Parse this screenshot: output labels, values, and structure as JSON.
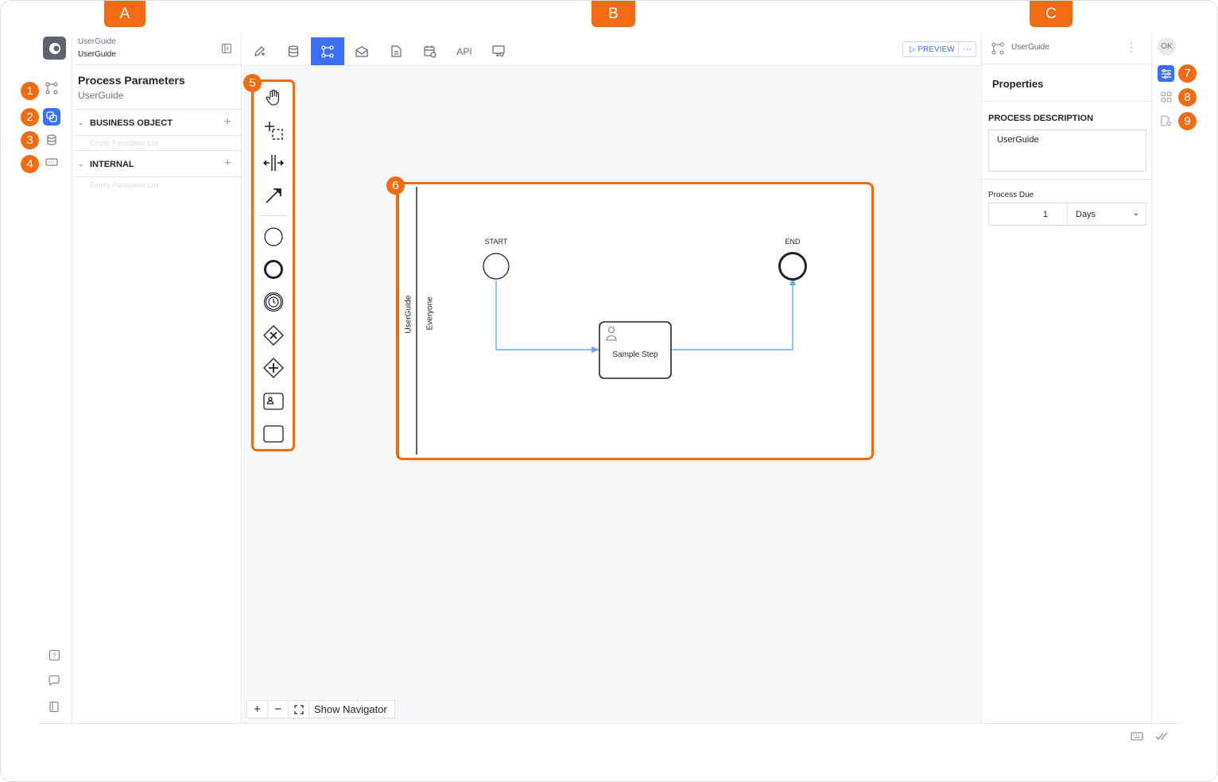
{
  "markers": {
    "a": "A",
    "b": "B",
    "c": "C",
    "n1": "1",
    "n2": "2",
    "n3": "3",
    "n4": "4",
    "n5": "5",
    "n6": "6",
    "n7": "7",
    "n8": "8",
    "n9": "9"
  },
  "app": {
    "project": "UserGuide",
    "process": "UserGuide"
  },
  "left_rail": {
    "items": [
      "process-flow-icon",
      "objects-icon",
      "database-icon",
      "input-icon"
    ],
    "bottom": [
      "help-icon",
      "chat-icon",
      "book-icon"
    ]
  },
  "parameters": {
    "title": "Process Parameters",
    "subtitle": "UserGuide",
    "sections": [
      {
        "label": "BUSINESS OBJECT",
        "empty": "Empty Parameter List"
      },
      {
        "label": "INTERNAL",
        "empty": "Empty Parameter List"
      }
    ]
  },
  "toolbar": {
    "api_label": "API",
    "preview_label": "PREVIEW",
    "more": "···"
  },
  "diagram": {
    "pool": "UserGuide",
    "lane": "Everyone",
    "start_label": "START",
    "end_label": "END",
    "task_label": "Sample Step",
    "flow_color": "#6aaaf0"
  },
  "zoom": {
    "plus": "+",
    "minus": "−",
    "navigator_label": "Show Navigator"
  },
  "properties": {
    "header_name": "UserGuide",
    "title": "Properties",
    "description_label": "PROCESS DESCRIPTION",
    "description_value": "UserGuide",
    "due_label": "Process Due",
    "due_value": "1",
    "due_unit": "Days"
  },
  "user": {
    "initials": "OK"
  },
  "colors": {
    "accent": "#3b6ff5",
    "marker": "#f26b12"
  }
}
